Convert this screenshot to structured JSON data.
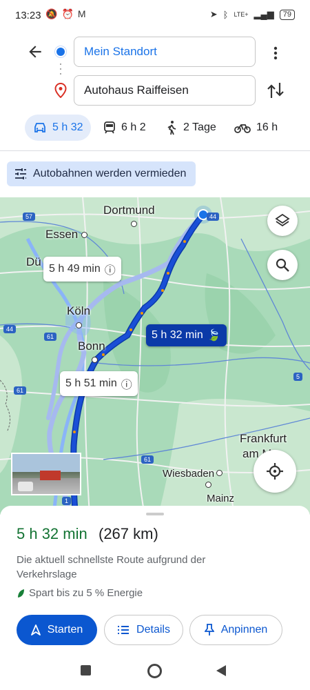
{
  "status_bar": {
    "time": "13:23",
    "battery": "79",
    "network": "LTE+"
  },
  "route": {
    "origin": "Mein Standort",
    "destination": "Autohaus Raiffeisen"
  },
  "modes": [
    {
      "icon": "car-icon",
      "label": "5 h 32",
      "active": true
    },
    {
      "icon": "train-icon",
      "label": "6 h 2",
      "active": false
    },
    {
      "icon": "walk-icon",
      "label": "2 Tage",
      "active": false
    },
    {
      "icon": "bike-icon",
      "label": "16 h",
      "active": false
    }
  ],
  "option_chip": "Autobahnen werden vermieden",
  "map": {
    "cities": [
      "Dortmund",
      "Essen",
      "Dü",
      "Köln",
      "Bonn",
      "Frankfurt",
      "am Ma",
      "Wiesbaden",
      "Mainz"
    ],
    "road_numbers": [
      "57",
      "44",
      "61",
      "44",
      "61",
      "5",
      "1",
      "61"
    ],
    "alt_route_1": "5 h 49 min",
    "alt_route_2": "5 h 51 min",
    "primary_route": "5 h 32 min",
    "colors": {
      "route": "#1a4fd6",
      "route_dark": "#0b3aa8",
      "alt_route": "#a6b9ef",
      "map_bg": "#a9dab9"
    }
  },
  "summary": {
    "duration": "5 h 32 min",
    "distance": "(267 km)",
    "description": "Die aktuell schnellste Route aufgrund der Verkehrslage",
    "energy": "Spart bis zu 5 % Energie"
  },
  "actions": {
    "start": "Starten",
    "details": "Details",
    "pin": "Anpinnen"
  }
}
